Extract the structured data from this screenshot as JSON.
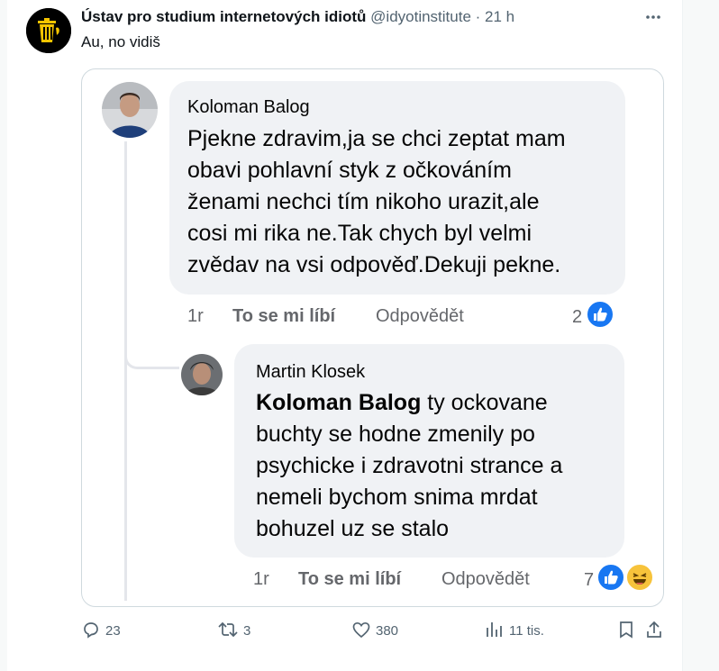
{
  "post": {
    "author_name": "Ústav pro studium internetových idiotů",
    "handle": "@idyotinstitute",
    "separator": " · ",
    "time": "21 h",
    "text": "Au, no vidiš"
  },
  "screenshot": {
    "comment": {
      "author": "Koloman Balog",
      "lines": [
        "Pjekne zdravim,ja se chci zeptat mam",
        "obavi pohlavní styk z očkováním",
        "ženami nechci tím nikoho urazit,ale",
        "cosi mi rika ne.Tak chych byl velmi",
        "zvědav na vsi odpověď.Dekuji pekne."
      ],
      "age": "1r",
      "like_label": "To se mi líbí",
      "reply_label": "Odpovědět",
      "reaction_count": "2"
    },
    "reply": {
      "author": "Martin Klosek",
      "mention": "Koloman Balog",
      "first_line_rest": " ty ockovane",
      "lines": [
        "buchty se hodne zmenily po",
        "psychicke i zdravotni strance a",
        "nemeli bychom snima mrdat",
        "bohuzel uz se stalo"
      ],
      "age": "1r",
      "like_label": "To se mi líbí",
      "reply_label": "Odpovědět",
      "reaction_count": "7"
    }
  },
  "footer": {
    "replies": "23",
    "reposts": "3",
    "likes": "380",
    "views": "11 tis."
  },
  "colors": {
    "fb_blue": "#1877f2",
    "haha_yellow": "#f7c33b",
    "bubble_bg": "#f0f2f5",
    "muted": "#536471"
  }
}
